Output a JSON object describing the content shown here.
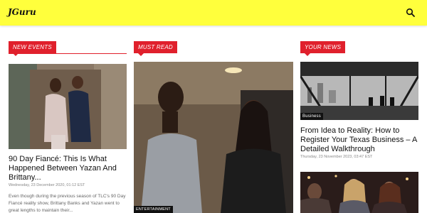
{
  "header": {
    "logo_text": "JGuru",
    "search_icon": "search-icon",
    "background_color": "#ffff3c"
  },
  "accent_color": "#e0202c",
  "columns": {
    "new_events": {
      "section_label": "NEW EVENTS",
      "article": {
        "title": "90 Day Fiancé: This Is What Happened Between Yazan And Brittany...",
        "date": "Wednesday, 23 December 2020, 01:12 EST",
        "excerpt": "Even though during the previous season of TLC's 90 Day Fiancé reality show, Brittany Banks and Yazan went to great lengths to maintain their..."
      }
    },
    "must_read": {
      "section_label": "MUST READ",
      "article": {
        "category_tag": "ENTERTAINMENT"
      }
    },
    "your_news": {
      "section_label": "YOUR NEWS",
      "article": {
        "category_tag": "Business",
        "title": "From Idea to Reality: How to Register Your Texas Business – A Detailed Walkthrough",
        "date": "Thursday, 23 November 2023, 03:47 EST"
      }
    }
  }
}
